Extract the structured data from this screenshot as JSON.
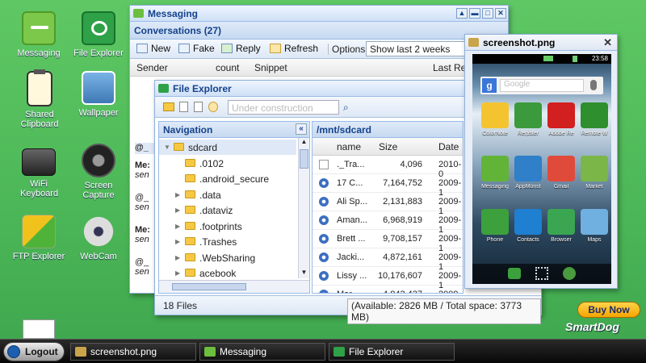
{
  "desktop": {
    "icons": [
      {
        "label": "Messaging"
      },
      {
        "label": "File Explorer"
      },
      {
        "label": "Shared Clipboard"
      },
      {
        "label": "Wallpaper"
      },
      {
        "label": "WiFi Keyboard"
      },
      {
        "label": "Screen Capture"
      },
      {
        "label": "FTP Explorer"
      },
      {
        "label": "WebCam"
      }
    ]
  },
  "messaging": {
    "title": "Messaging",
    "panel_title": "Conversations (27)",
    "toolbar": {
      "new": "New",
      "fake": "Fake",
      "reply": "Reply",
      "refresh": "Refresh",
      "options_label": "Options:",
      "options_value": "Show last 2 weeks"
    },
    "columns": {
      "sender": "Sender",
      "count": "count",
      "snippet": "Snippet",
      "last": "Last Re"
    },
    "left_rows": [
      {
        "a": "@_",
        "b": ""
      },
      {
        "a": "Me:",
        "b": "sen"
      },
      {
        "a": "@_",
        "b": "sen"
      },
      {
        "a": "Me:",
        "b": "sen"
      },
      {
        "a": "@_",
        "b": "sen"
      }
    ]
  },
  "explorer": {
    "title": "File Explorer",
    "search_placeholder": "Under construction",
    "nav_title": "Navigation",
    "path_title": "/mnt/sdcard",
    "tree": [
      {
        "name": "sdcard",
        "level": 0,
        "expand": "▼"
      },
      {
        "name": ".0102",
        "level": 1,
        "expand": ""
      },
      {
        "name": ".android_secure",
        "level": 1,
        "expand": ""
      },
      {
        "name": ".data",
        "level": 1,
        "expand": "▶"
      },
      {
        "name": ".dataviz",
        "level": 1,
        "expand": "▶"
      },
      {
        "name": ".footprints",
        "level": 1,
        "expand": "▶"
      },
      {
        "name": ".Trashes",
        "level": 1,
        "expand": "▶"
      },
      {
        "name": ".WebSharing",
        "level": 1,
        "expand": "▶"
      },
      {
        "name": "acebook",
        "level": 1,
        "expand": "▶"
      }
    ],
    "columns": {
      "name": "name",
      "size": "Size",
      "date": "Date"
    },
    "files": [
      {
        "name": "._Tra...",
        "size": "4,096",
        "date": "2010-0"
      },
      {
        "name": "17 C...",
        "size": "7,164,752",
        "date": "2009-1"
      },
      {
        "name": "Ali Sp...",
        "size": "2,131,883",
        "date": "2009-1"
      },
      {
        "name": "Aman...",
        "size": "6,968,919",
        "date": "2009-1"
      },
      {
        "name": "Brett ...",
        "size": "9,708,157",
        "date": "2009-1"
      },
      {
        "name": "Jacki...",
        "size": "4,872,161",
        "date": "2009-1"
      },
      {
        "name": "Lissy ...",
        "size": "10,176,607",
        "date": "2009-1"
      },
      {
        "name": "Mar...",
        "size": "4,843,437",
        "date": "2009-1"
      }
    ],
    "status_left": "18 Files",
    "status_right": "(Available: 2826 MB / Total space: 3773 MB)"
  },
  "screenshot_win": {
    "title": "screenshot.png",
    "time": "23:58",
    "google_label": "Google",
    "apps": [
      {
        "label": "ColorNote",
        "color": "#f4c430"
      },
      {
        "label": "Register",
        "color": "#3b9a3b"
      },
      {
        "label": "Adobe Re",
        "color": "#d21f1f"
      },
      {
        "label": "Remote W",
        "color": "#2d8f2d"
      },
      {
        "label": "Messaging",
        "color": "#62b438"
      },
      {
        "label": "AppMonst",
        "color": "#2f7fc9"
      },
      {
        "label": "Gmail",
        "color": "#e04a3b"
      },
      {
        "label": "Market",
        "color": "#7ab648"
      },
      {
        "label": "Phone",
        "color": "#3ca03c"
      },
      {
        "label": "Contacts",
        "color": "#1f7fd0"
      },
      {
        "label": "Browser",
        "color": "#3aa652"
      },
      {
        "label": "Maps",
        "color": "#6fb0e0"
      }
    ]
  },
  "buynow": {
    "label": "Buy Now",
    "brand": "SmartDog"
  },
  "taskbar": {
    "logout": "Logout",
    "tasks": [
      {
        "label": "screenshot.png"
      },
      {
        "label": "Messaging"
      },
      {
        "label": "File Explorer"
      }
    ]
  }
}
